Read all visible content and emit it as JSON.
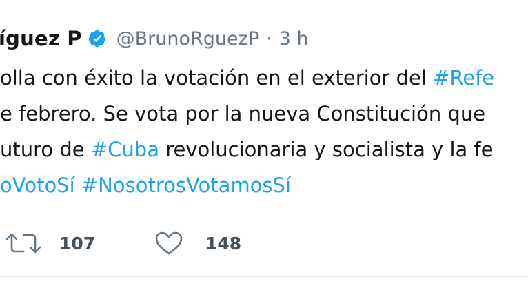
{
  "tweet": {
    "author_name": "íguez P",
    "handle": "@BrunoRguezP",
    "separator": "·",
    "time": "3 h",
    "lines": [
      {
        "parts": [
          "olla con éxito la votación en el exterior del ",
          "#Refe"
        ]
      },
      {
        "parts": [
          "e febrero. Se vota por la nueva Constitución que"
        ]
      },
      {
        "parts": [
          "uturo de ",
          "#Cuba",
          " revolucionaria y socialista y la fe"
        ]
      },
      {
        "parts": [
          "oVotoSí",
          " ",
          "#NosotrosVotamosSí"
        ]
      }
    ],
    "retweet_count": "107",
    "like_count": "148",
    "icons": {
      "verified": "verified-badge-icon",
      "retweet": "retweet-icon",
      "like": "heart-icon"
    },
    "colors": {
      "hashtag": "#1da1f2",
      "meta": "#657786",
      "text": "#14171a"
    }
  }
}
